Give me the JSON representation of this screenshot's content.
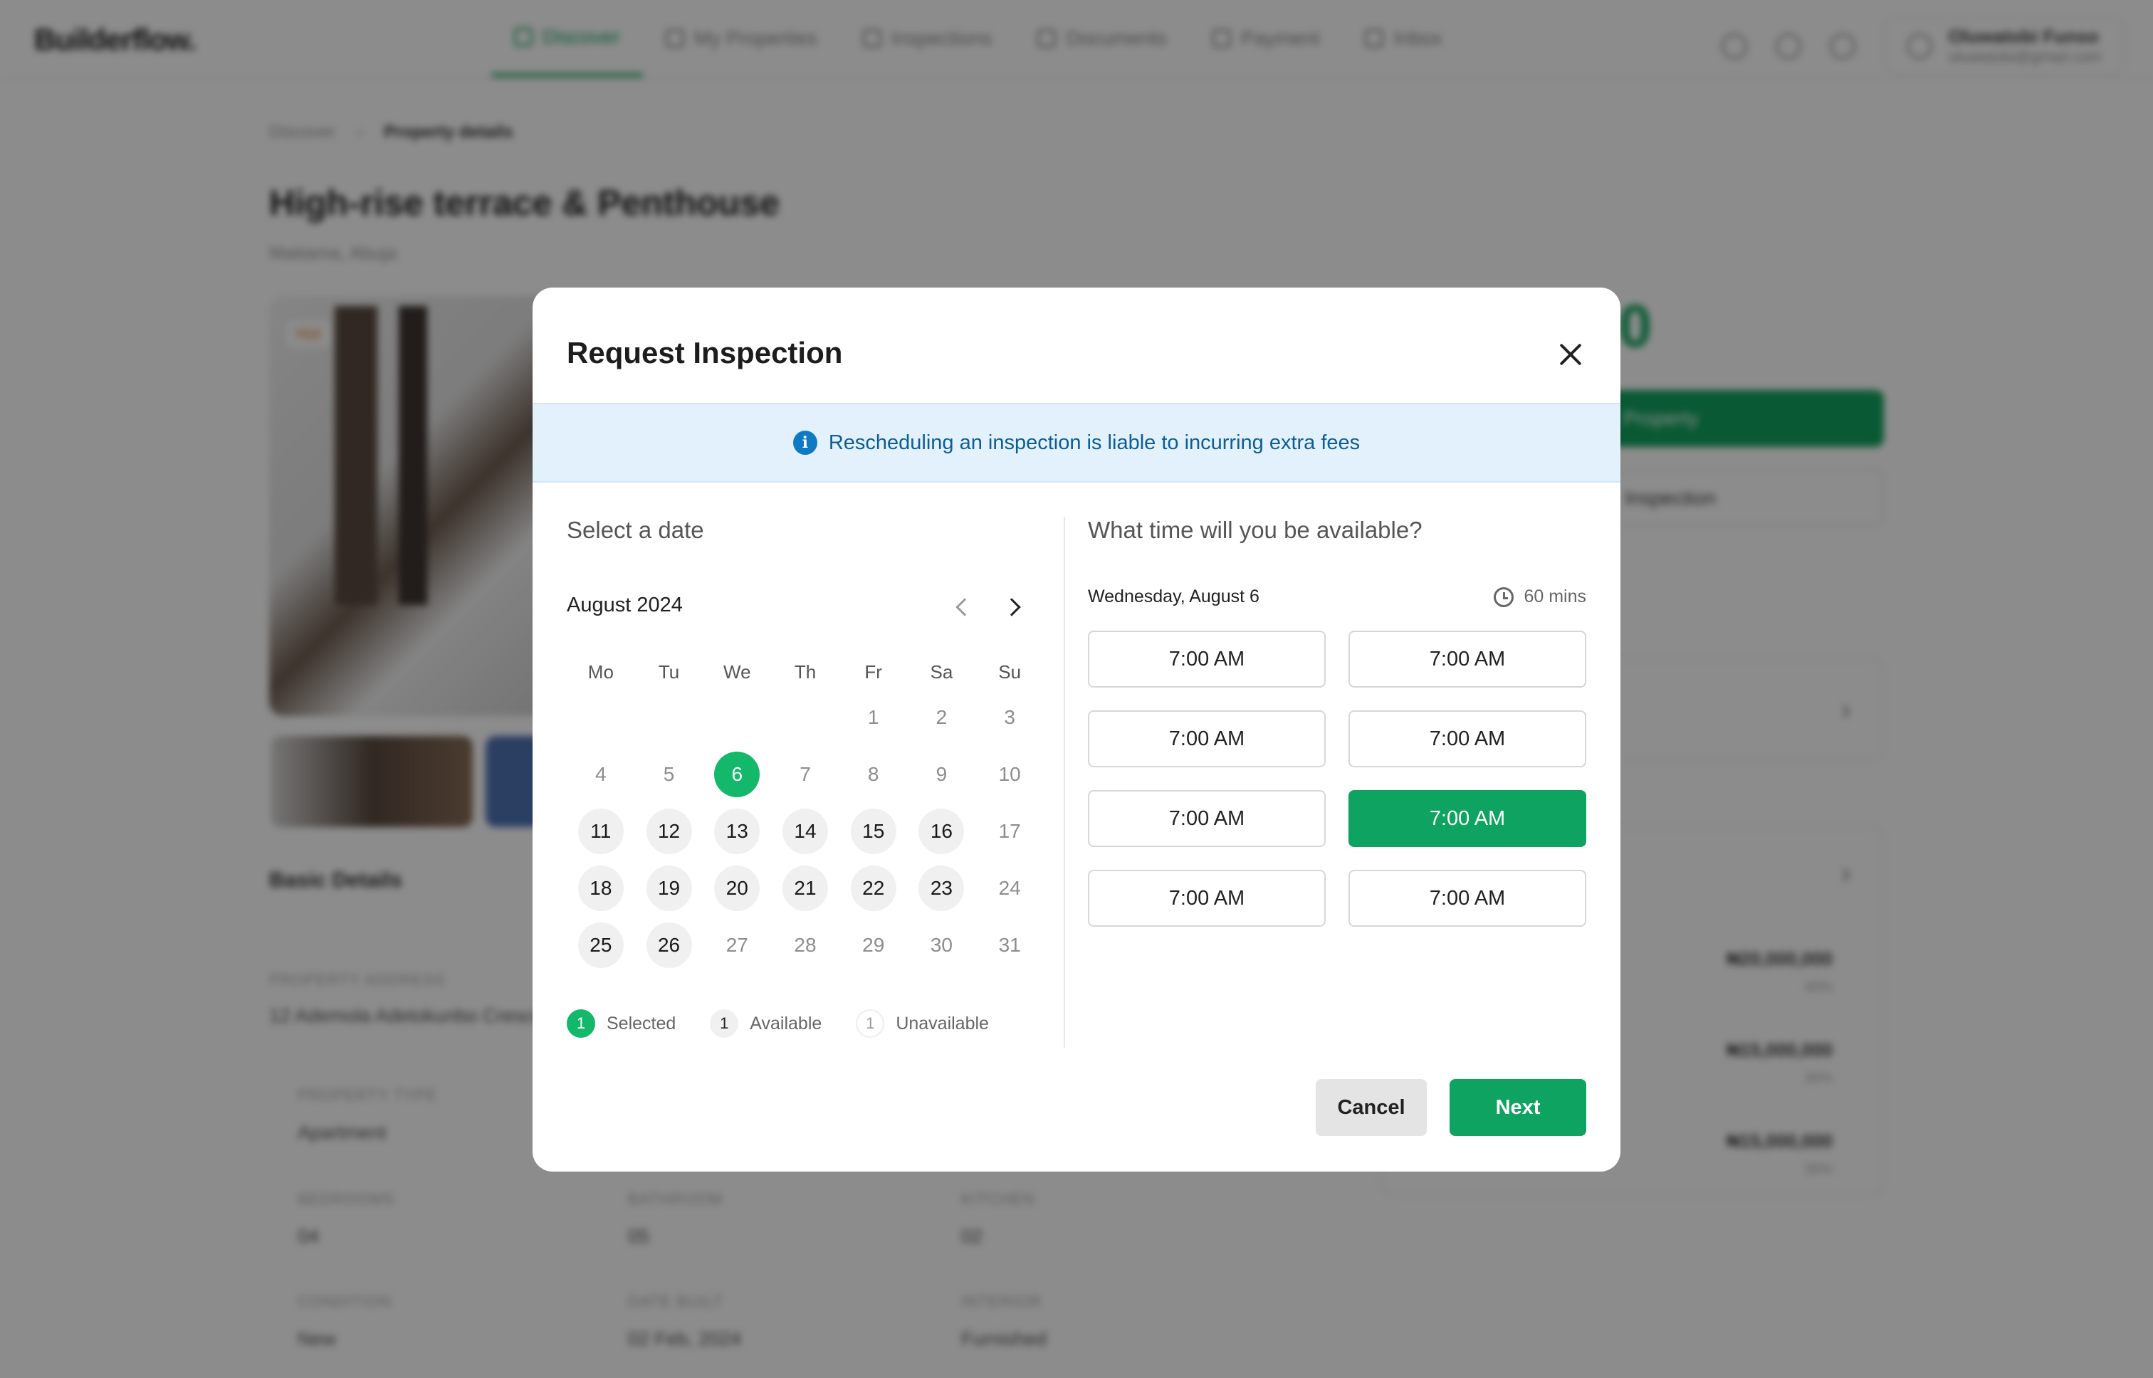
{
  "app": {
    "logo": "Builderflow.",
    "nav": [
      "Discover",
      "My Properties",
      "Inspections",
      "Documents",
      "Payment",
      "Inbox"
    ],
    "user": {
      "name": "Oluwatobi Funso",
      "email": "oluwatobi@gmail.com"
    }
  },
  "background": {
    "breadcrumb": [
      "Discover",
      "Property details"
    ],
    "title": "High-rise terrace & Penthouse",
    "location": "Maitama, Abuja",
    "badge": "Hot",
    "section": "Basic Details",
    "address_label": "PROPERTY ADDRESS",
    "address": "12 Ademola Adetokunbo Crescent",
    "fields": [
      {
        "label": "PROPERTY TYPE",
        "value": "Apartment"
      },
      {
        "label": "BEDROOMS",
        "value": "04"
      },
      {
        "label": "BATHROOM",
        "value": "05"
      },
      {
        "label": "KITCHEN",
        "value": "02"
      },
      {
        "label": "CONDITION",
        "value": "New"
      },
      {
        "label": "DATE BUILT",
        "value": "02 Feb, 2024"
      },
      {
        "label": "INTERIOR",
        "value": "Furnished"
      }
    ],
    "price_fragment": "000",
    "buy_label": "Property",
    "inspection_label": "Inspection",
    "payments": [
      {
        "amount": "₦20,000,000",
        "pct": "40%"
      },
      {
        "amount": "₦15,000,000",
        "pct": "30%"
      },
      {
        "amount": "₦15,000,000",
        "pct": "30%"
      }
    ]
  },
  "modal": {
    "title": "Request Inspection",
    "notice": "Rescheduling an inspection is liable to incurring extra fees",
    "date_heading": "Select a date",
    "month_label": "August 2024",
    "weekdays": [
      "Mo",
      "Tu",
      "We",
      "Th",
      "Fr",
      "Sa",
      "Su"
    ],
    "weeks": [
      [
        {
          "d": ""
        },
        {
          "d": ""
        },
        {
          "d": ""
        },
        {
          "d": ""
        },
        {
          "d": "1",
          "s": "unavailable"
        },
        {
          "d": "2",
          "s": "unavailable"
        },
        {
          "d": "3",
          "s": "unavailable"
        }
      ],
      [
        {
          "d": "4",
          "s": "unavailable"
        },
        {
          "d": "5",
          "s": "unavailable"
        },
        {
          "d": "6",
          "s": "selected"
        },
        {
          "d": "7",
          "s": "unavailable"
        },
        {
          "d": "8",
          "s": "unavailable"
        },
        {
          "d": "9",
          "s": "unavailable"
        },
        {
          "d": "10",
          "s": "unavailable"
        }
      ],
      [
        {
          "d": "11",
          "s": "available"
        },
        {
          "d": "12",
          "s": "available"
        },
        {
          "d": "13",
          "s": "available"
        },
        {
          "d": "14",
          "s": "available"
        },
        {
          "d": "15",
          "s": "available"
        },
        {
          "d": "16",
          "s": "available"
        },
        {
          "d": "17",
          "s": "unavailable"
        }
      ],
      [
        {
          "d": "18",
          "s": "available"
        },
        {
          "d": "19",
          "s": "available"
        },
        {
          "d": "20",
          "s": "available"
        },
        {
          "d": "21",
          "s": "available"
        },
        {
          "d": "22",
          "s": "available"
        },
        {
          "d": "23",
          "s": "available"
        },
        {
          "d": "24",
          "s": "unavailable"
        }
      ],
      [
        {
          "d": "25",
          "s": "available"
        },
        {
          "d": "26",
          "s": "available"
        },
        {
          "d": "27",
          "s": "unavailable"
        },
        {
          "d": "28",
          "s": "unavailable"
        },
        {
          "d": "29",
          "s": "unavailable"
        },
        {
          "d": "30",
          "s": "unavailable"
        },
        {
          "d": "31",
          "s": "unavailable"
        }
      ]
    ],
    "legend": [
      {
        "num": "1",
        "label": "Selected",
        "kind": "sel"
      },
      {
        "num": "1",
        "label": "Available",
        "kind": "avl"
      },
      {
        "num": "1",
        "label": "Unavailable",
        "kind": "una"
      }
    ],
    "time_heading": "What time will you be available?",
    "selected_date": "Wednesday, August 6",
    "duration": "60 mins",
    "slots": [
      "7:00 AM",
      "7:00 AM",
      "7:00 AM",
      "7:00 AM",
      "7:00 AM",
      "7:00 AM",
      "7:00 AM",
      "7:00 AM"
    ],
    "active_slot": 5,
    "cancel_label": "Cancel",
    "next_label": "Next"
  },
  "colors": {
    "accent": "#0ea360",
    "selected_day": "#13b86a",
    "notice_bg": "#e3f1fc",
    "notice_text": "#0b5e96"
  }
}
